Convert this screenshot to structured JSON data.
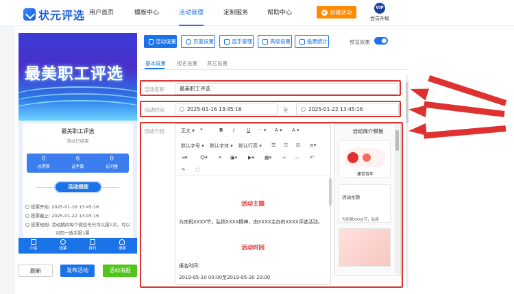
{
  "app": {
    "logo_text": "状元评选"
  },
  "nav": {
    "items": [
      "用户首页",
      "模板中心",
      "活动管理",
      "定制服务",
      "帮助中心"
    ],
    "active_index": 2,
    "create_button": "创建活动",
    "vip_badge": "VIP",
    "vip_label": "会员升级"
  },
  "preview": {
    "banner_title": "最美职工评选",
    "card_title": "最美职工评选",
    "status": "活动已结束",
    "stats": [
      {
        "value": "0",
        "label": "总票数"
      },
      {
        "value": "6",
        "label": "选手数"
      },
      {
        "value": "0",
        "label": "访问量"
      }
    ],
    "rules_title": "活动规则",
    "info_lines": [
      "投票开始: 2025-01-16 13:45:16",
      "投票截止: 2025-01-22 13:45:16",
      "投票规则: 活动期间每个微信号只可以投1次，可以",
      "对同一选手投1票"
    ],
    "tabs": [
      "介绍",
      "投票",
      "排行",
      "搜索"
    ]
  },
  "left_buttons": {
    "refresh": "刷新",
    "publish": "发布活动",
    "poster": "活动海报"
  },
  "toolbar": {
    "buttons": [
      "活动设置",
      "页面设置",
      "选手管理",
      "高级设置",
      "投票统计"
    ],
    "active_index": 0,
    "preview_label": "预览效果"
  },
  "subtabs": {
    "items": [
      "基本设置",
      "报名设置",
      "其它设置"
    ],
    "active_index": 0
  },
  "form": {
    "name_label": "活动名称",
    "name_value": "最美职工评选",
    "time_label": "活动时间",
    "time_start": "2025-01-16 13:45:16",
    "time_sep": "至",
    "time_end": "2025-01-22 13:45:16",
    "intro_label": "活动介绍"
  },
  "editor": {
    "row1": [
      "正文",
      "❝",
      "B",
      "I",
      "U",
      "···",
      "A",
      "A"
    ],
    "row2": [
      "默认字号",
      "默认字体",
      "默认行高"
    ],
    "content": {
      "heading1": "活动主题",
      "text1": "为庆祝XXXX节，弘扬XXXX精神，由XXXX主办的XXXX评选活动。",
      "heading2": "活动时间",
      "text2": "报名时间:",
      "text3": "2019-05-10 00:00至2019-05-20 20:00"
    }
  },
  "template_panel": {
    "title": "活动简介模板",
    "card1_caption": "建党百年",
    "card2_title": "活动主题",
    "card2_text": "为庆祝XXXX节，弘扬"
  },
  "colors": {
    "primary": "#1a73e8",
    "orange": "#ff8a00",
    "green": "#52c41a",
    "highlight": "#e03131"
  }
}
